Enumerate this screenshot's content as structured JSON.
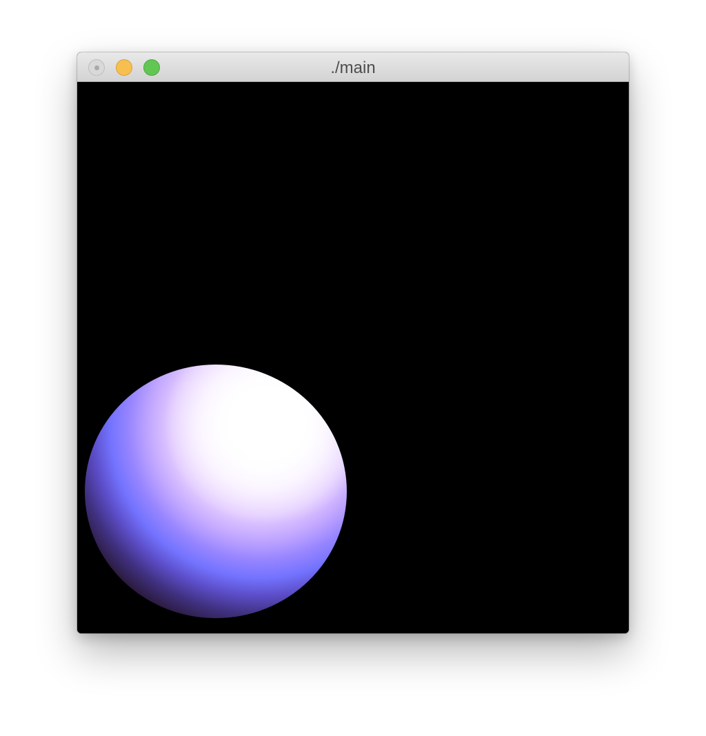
{
  "window": {
    "title": "./main",
    "controls": {
      "close": "close-button",
      "minimize": "minimize-button",
      "zoom": "zoom-button"
    }
  },
  "scene": {
    "background": "#000000",
    "object": "sphere",
    "highlight_color": "#ffffff",
    "diffuse_color": "#7373ff",
    "shadow_color": "#2c1c42"
  }
}
